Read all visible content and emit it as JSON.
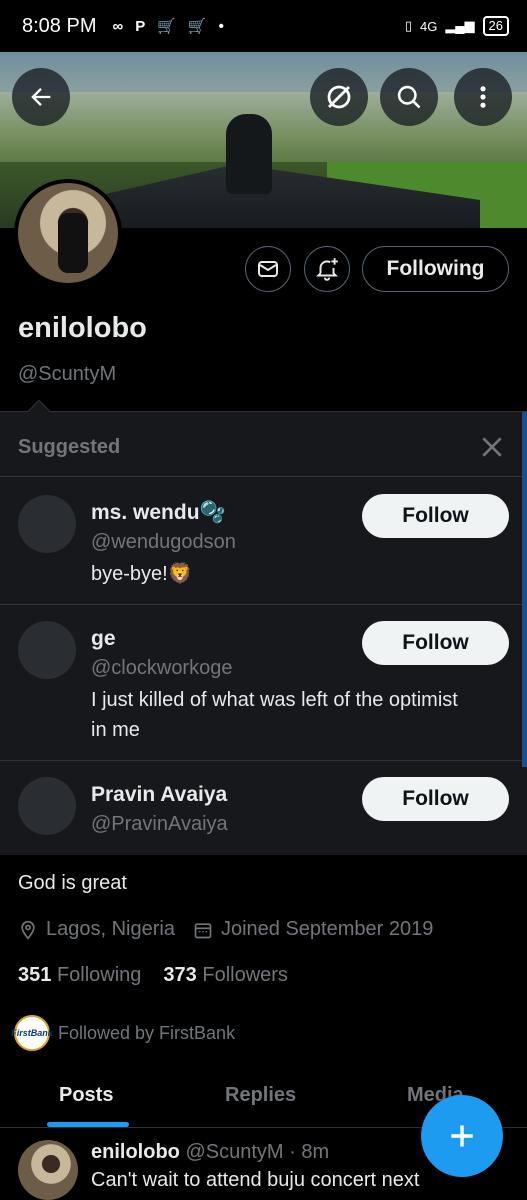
{
  "status_bar": {
    "time": "8:08 PM",
    "network": "4G",
    "battery": "26"
  },
  "header": {
    "back_icon": "arrow-left-icon",
    "grok_icon": "slash-circle-icon",
    "search_icon": "search-icon",
    "more_icon": "more-vertical-icon"
  },
  "profile": {
    "display_name": "enilolobo",
    "handle": "@ScuntyM",
    "following_button": "Following",
    "bio": "God is great",
    "location": "Lagos, Nigeria",
    "joined": "Joined September 2019",
    "following_count": "351",
    "following_label": "Following",
    "followers_count": "373",
    "followers_label": "Followers",
    "followed_by": "Followed by FirstBank",
    "followed_by_logo_text": "FirstBank"
  },
  "suggested": {
    "title": "Suggested",
    "items": [
      {
        "name": "ms. wendu🫧",
        "handle": "@wendugodson",
        "bio": "bye-bye!🦁",
        "button": "Follow"
      },
      {
        "name": "ge",
        "handle": "@clockworkoge",
        "bio": "I just killed of what was left of the optimist in me",
        "button": "Follow"
      },
      {
        "name": "Pravin Avaiya",
        "handle": "@PravinAvaiya",
        "bio": "",
        "button": "Follow"
      }
    ]
  },
  "tabs": [
    {
      "label": "Posts",
      "active": true
    },
    {
      "label": "Replies",
      "active": false
    },
    {
      "label": "Media",
      "active": false
    }
  ],
  "tweet": {
    "name": "enilolobo",
    "handle_time": "@ScuntyM · 8m",
    "text": "Can't wait to attend buju concert next"
  },
  "colors": {
    "accent": "#1d9bf0",
    "muted": "#71767b",
    "panel": "#16181c"
  }
}
